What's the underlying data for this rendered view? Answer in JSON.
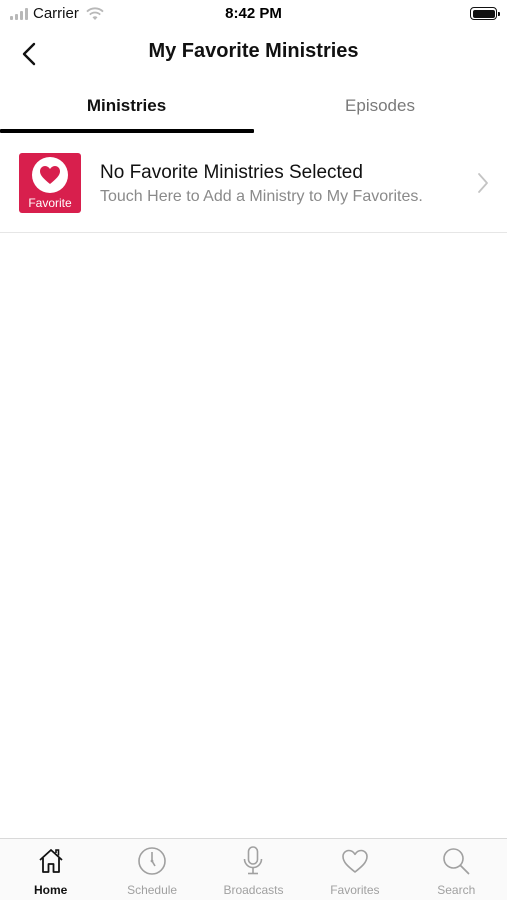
{
  "status_bar": {
    "carrier": "Carrier",
    "time": "8:42 PM"
  },
  "nav": {
    "title": "My Favorite Ministries",
    "back_icon": "chevron-left-icon"
  },
  "tabs": [
    {
      "label": "Ministries",
      "active": true
    },
    {
      "label": "Episodes",
      "active": false
    }
  ],
  "row": {
    "badge_label": "Favorite",
    "title": "No Favorite Ministries Selected",
    "subtitle": "Touch Here to Add a Ministry to My Favorites."
  },
  "tab_bar": {
    "items": [
      {
        "label": "Home",
        "icon": "home-icon",
        "active": true
      },
      {
        "label": "Schedule",
        "icon": "clock-icon",
        "active": false
      },
      {
        "label": "Broadcasts",
        "icon": "microphone-icon",
        "active": false
      },
      {
        "label": "Favorites",
        "icon": "heart-icon",
        "active": false
      },
      {
        "label": "Search",
        "icon": "search-icon",
        "active": false
      }
    ]
  },
  "colors": {
    "accent": "#d81f4d",
    "active_text": "#111111",
    "inactive_text": "#a0a0a0"
  }
}
